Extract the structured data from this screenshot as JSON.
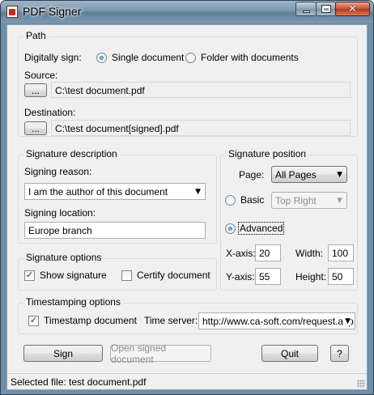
{
  "window": {
    "title": "PDF Signer"
  },
  "path": {
    "group_title": "Path",
    "digitally_sign_label": "Digitally sign:",
    "single_document_label": "Single document",
    "folder_label": "Folder with documents",
    "source_label": "Source:",
    "source_browse_label": "...",
    "source_value": "C:\\test document.pdf",
    "destination_label": "Destination:",
    "destination_browse_label": "...",
    "destination_value": "C:\\test document[signed].pdf"
  },
  "signature_description": {
    "group_title": "Signature description",
    "reason_label": "Signing reason:",
    "reason_value": "I am the author of this document",
    "location_label": "Signing location:",
    "location_value": "Europe branch"
  },
  "signature_position": {
    "group_title": "Signature position",
    "page_label": "Page:",
    "page_value": "All Pages",
    "basic_label": "Basic",
    "basic_position_value": "Top Right",
    "advanced_label": "Advanced",
    "x_label": "X-axis:",
    "x_value": "20",
    "y_label": "Y-axis:",
    "y_value": "55",
    "width_label": "Width:",
    "width_value": "100",
    "height_label": "Height:",
    "height_value": "50"
  },
  "signature_options": {
    "group_title": "Signature options",
    "show_signature_label": "Show signature",
    "certify_label": "Certify document"
  },
  "timestamping": {
    "group_title": "Timestamping options",
    "timestamp_label": "Timestamp document",
    "server_label": "Time server:",
    "server_value": "http://www.ca-soft.com/request.asp"
  },
  "buttons": {
    "sign": "Sign",
    "open_signed": "Open signed document",
    "quit": "Quit",
    "help": "?"
  },
  "statusbar": {
    "text": "Selected file: test document.pdf"
  }
}
